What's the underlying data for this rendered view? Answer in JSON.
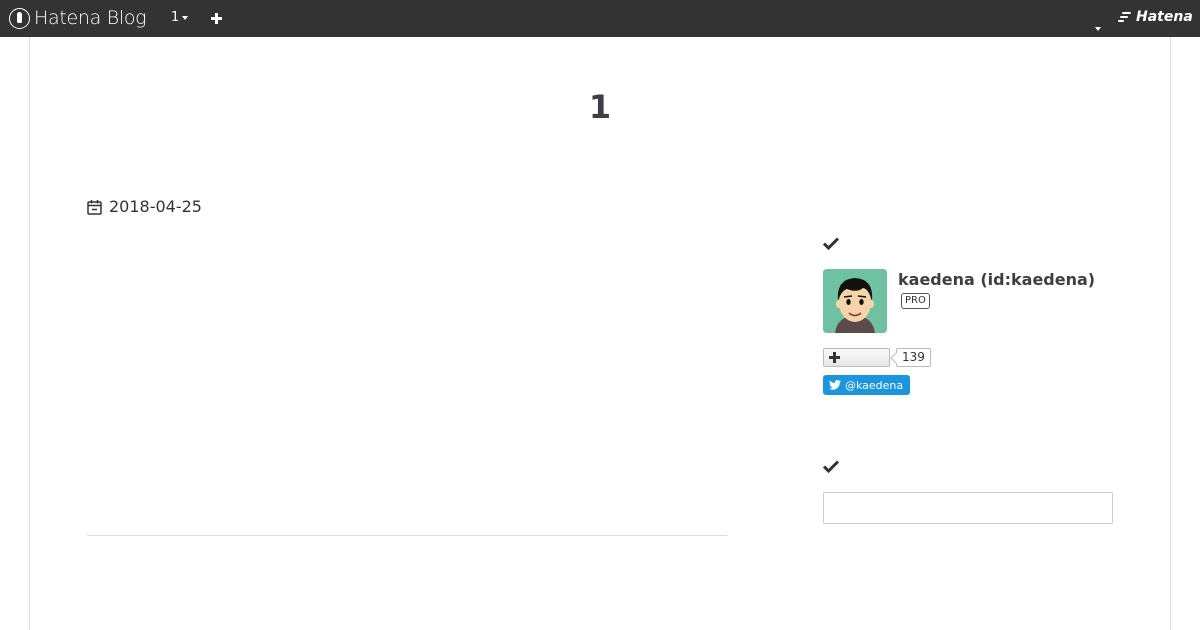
{
  "topbar": {
    "brand": "Hatena Blog",
    "blog_selector": "1",
    "hatena_label": "Hatena"
  },
  "blog": {
    "title": "1"
  },
  "entry": {
    "date": "2018-04-25"
  },
  "sidebar": {
    "profile": {
      "name": "kaedena (id:kaedena)",
      "badge": "PRO",
      "follower_count": "139",
      "twitter_handle": "@kaedena"
    },
    "search": {
      "value": ""
    }
  },
  "colors": {
    "topbar_bg": "#333333",
    "twitter_blue": "#1b95e0",
    "avatar_bg": "#6fc2a1"
  },
  "icons": [
    "hatena-blog-logo-icon",
    "caret-down-icon",
    "plus-icon",
    "hatena-logo-icon",
    "calendar-icon",
    "check-icon",
    "twitter-icon"
  ]
}
